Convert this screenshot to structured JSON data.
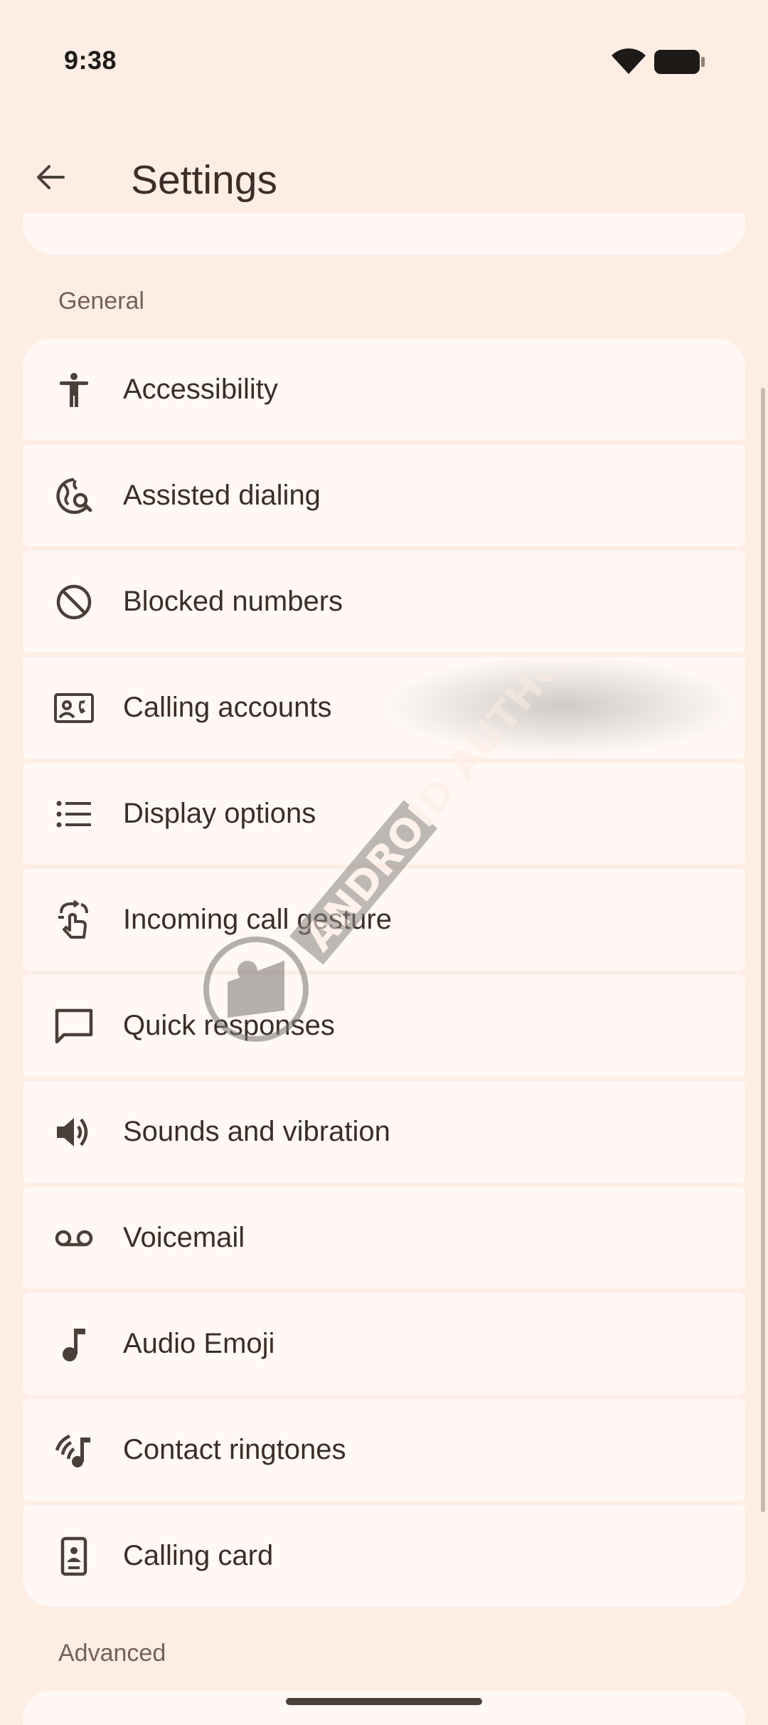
{
  "status_bar": {
    "time": "9:38"
  },
  "header": {
    "title": "Settings"
  },
  "sections": {
    "general": "General",
    "advanced": "Advanced"
  },
  "items": [
    {
      "label": "Accessibility",
      "icon": "accessibility-icon"
    },
    {
      "label": "Assisted dialing",
      "icon": "assisted-dialing-icon"
    },
    {
      "label": "Blocked numbers",
      "icon": "block-icon"
    },
    {
      "label": "Calling accounts",
      "icon": "calling-accounts-icon"
    },
    {
      "label": "Display options",
      "icon": "list-icon"
    },
    {
      "label": "Incoming call gesture",
      "icon": "gesture-icon"
    },
    {
      "label": "Quick responses",
      "icon": "chat-bubble-icon"
    },
    {
      "label": "Sounds and vibration",
      "icon": "volume-icon"
    },
    {
      "label": "Voicemail",
      "icon": "voicemail-icon"
    },
    {
      "label": "Audio Emoji",
      "icon": "music-note-icon"
    },
    {
      "label": "Contact ringtones",
      "icon": "contact-ringtone-icon"
    },
    {
      "label": "Calling card",
      "icon": "calling-card-icon"
    }
  ],
  "watermark": {
    "text": "ANDROID AUTHORITY"
  },
  "colors": {
    "background": "#FDEDE3",
    "card": "#FFF8F4",
    "text": "#3A2E27",
    "section_header": "#74625A",
    "icon": "#4A3F39"
  }
}
